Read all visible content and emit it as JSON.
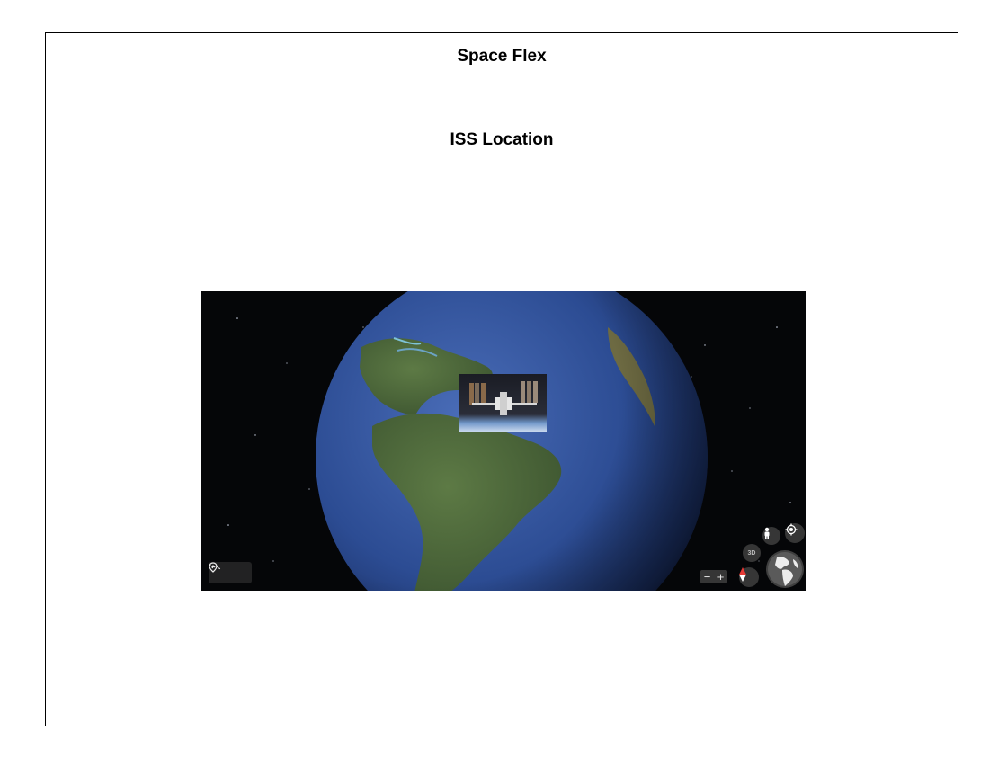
{
  "header": {
    "title": "Space Flex"
  },
  "section": {
    "title": "ISS Location"
  },
  "map": {
    "zoom_out_label": "−",
    "zoom_in_label": "+",
    "view_3d_label": "3D",
    "icons": [
      "location-pin-icon",
      "measure-path-icon",
      "pegman-icon",
      "my-location-icon",
      "compass-icon",
      "mini-globe-icon"
    ]
  },
  "colors": {
    "frame_border": "#000000",
    "space_background": "#050608",
    "ocean": "#2f4f9a",
    "land": "#4f6a3c",
    "control_background": "#3c3c3c"
  }
}
